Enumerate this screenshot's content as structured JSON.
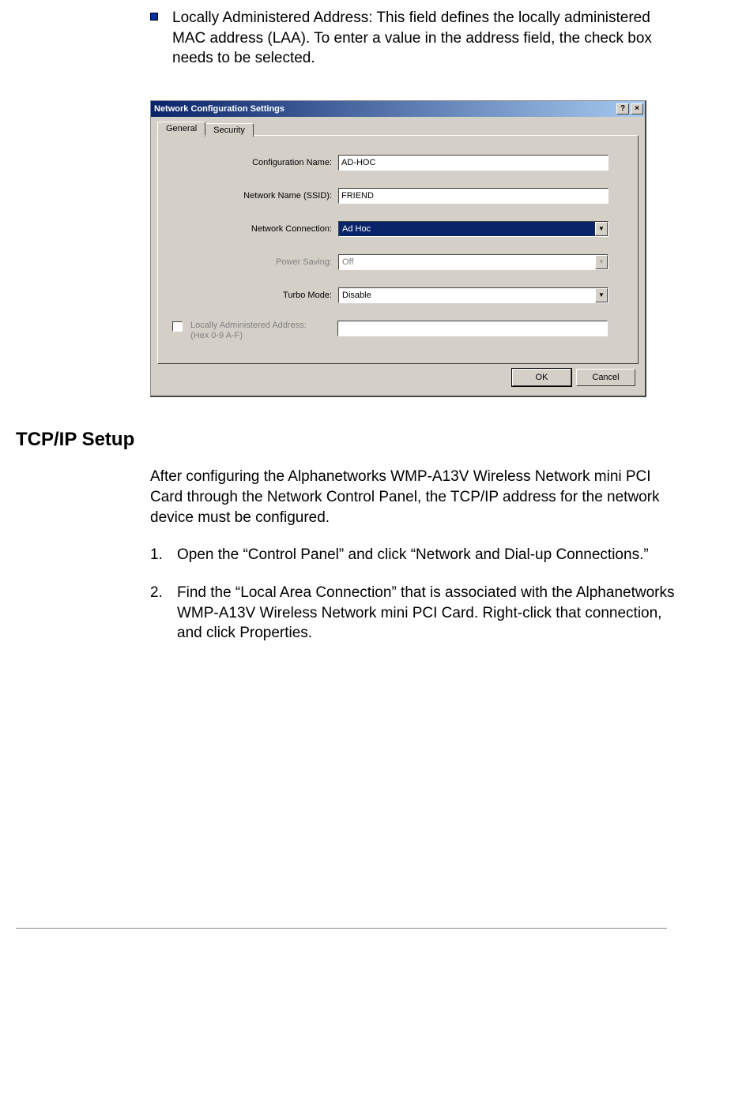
{
  "bullet": {
    "text": "Locally Administered Address: This field defines the locally administered MAC address (LAA). To enter a value in the address field, the check box needs to be selected."
  },
  "dialog": {
    "title": "Network Configuration Settings",
    "help_btn": "?",
    "close_btn": "×",
    "tabs": {
      "general": "General",
      "security": "Security"
    },
    "labels": {
      "config_name": "Configuration Name:",
      "ssid": "Network Name (SSID):",
      "connection": "Network Connection:",
      "power": "Power Saving:",
      "turbo": "Turbo Mode:",
      "laa": "Locally Administered Address:\n(Hex 0-9 A-F)"
    },
    "values": {
      "config_name": "AD-HOC",
      "ssid": "FRIEND",
      "connection": "Ad Hoc",
      "power": "Off",
      "turbo": "Disable",
      "laa": ""
    },
    "buttons": {
      "ok": "OK",
      "cancel": "Cancel"
    }
  },
  "heading": "TCP/IP Setup",
  "paragraph": "After configuring the Alphanetworks WMP-A13V Wireless Network mini PCI Card through the Network Control Panel, the TCP/IP address for the network device must be configured.",
  "steps": [
    {
      "num": "1.",
      "text": "Open the “Control Panel” and click “Network and Dial-up Connections.”"
    },
    {
      "num": "2.",
      "text": "Find the “Local Area Connection” that is associated with the Alphanetworks WMP-A13V Wireless Network mini PCI Card. Right-click that connection, and click Properties."
    }
  ]
}
